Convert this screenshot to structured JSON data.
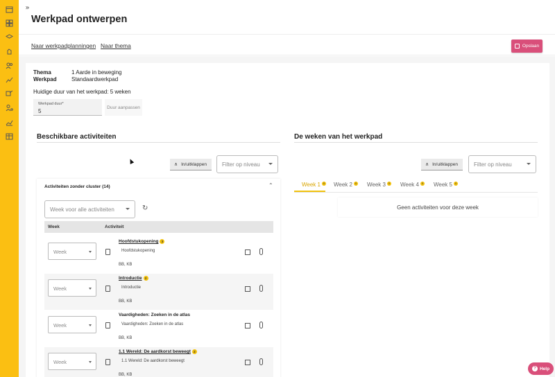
{
  "topbar": {
    "title": "Werkpad ontwerpen",
    "collapse_icon": "»"
  },
  "subnav": {
    "link_planningen": "Naar werkpadplanningen",
    "link_thema": "Naar thema",
    "save_label": "Opslaan"
  },
  "info": {
    "thema_label": "Thema",
    "thema_value": "1 Aarde in beweging",
    "werkpad_label": "Werkpad",
    "werkpad_value": "Standaardwerkpad",
    "duration_text": "Huidige duur van het werkpad: 5 weken",
    "duration_field_label": "Werkpad duur*",
    "duration_field_value": "5",
    "duration_button": "Duur aanpassen"
  },
  "left": {
    "title": "Beschikbare activiteiten",
    "toggle_label": "In/uitklappen",
    "filter_placeholder": "Filter op niveau",
    "cluster_title": "Activiteiten zonder cluster (14)",
    "week_all_placeholder": "Week voor alle activiteiten",
    "col_week": "Week",
    "col_activity": "Activiteit",
    "week_placeholder": "Week",
    "activities": [
      {
        "title": "Hoofdstukopening",
        "badge": "3",
        "sub": "Hoofdstukopening",
        "levels": "BB, KB"
      },
      {
        "title": "Introductie",
        "badge": "2",
        "sub": "Introductie",
        "levels": "BB, KB"
      },
      {
        "title": "Vaardigheden: Zoeken in de atlas",
        "badge": "",
        "sub": "Vaardigheden: Zoeken in de atlas",
        "levels": "BB, KB"
      },
      {
        "title": "1.1 Wereld: De aardkorst beweegt",
        "badge": "2",
        "sub": "1.1 Wereld: De aardkorst beweegt",
        "levels": "BB, KB"
      }
    ]
  },
  "right": {
    "title": "De weken van het werkpad",
    "toggle_label": "In/uitklappen",
    "filter_placeholder": "Filter op niveau",
    "tabs": [
      {
        "label": "Week 1",
        "badge": "0"
      },
      {
        "label": "Week 2",
        "badge": "0"
      },
      {
        "label": "Week 3",
        "badge": "0"
      },
      {
        "label": "Week 4",
        "badge": "0"
      },
      {
        "label": "Week 5",
        "badge": "0"
      }
    ],
    "empty_text": "Geen activiteiten voor deze week"
  },
  "help_label": "Help",
  "colors": {
    "rail": "#fbbf12",
    "accent": "#d94f7a",
    "badge": "#f2c10c"
  }
}
